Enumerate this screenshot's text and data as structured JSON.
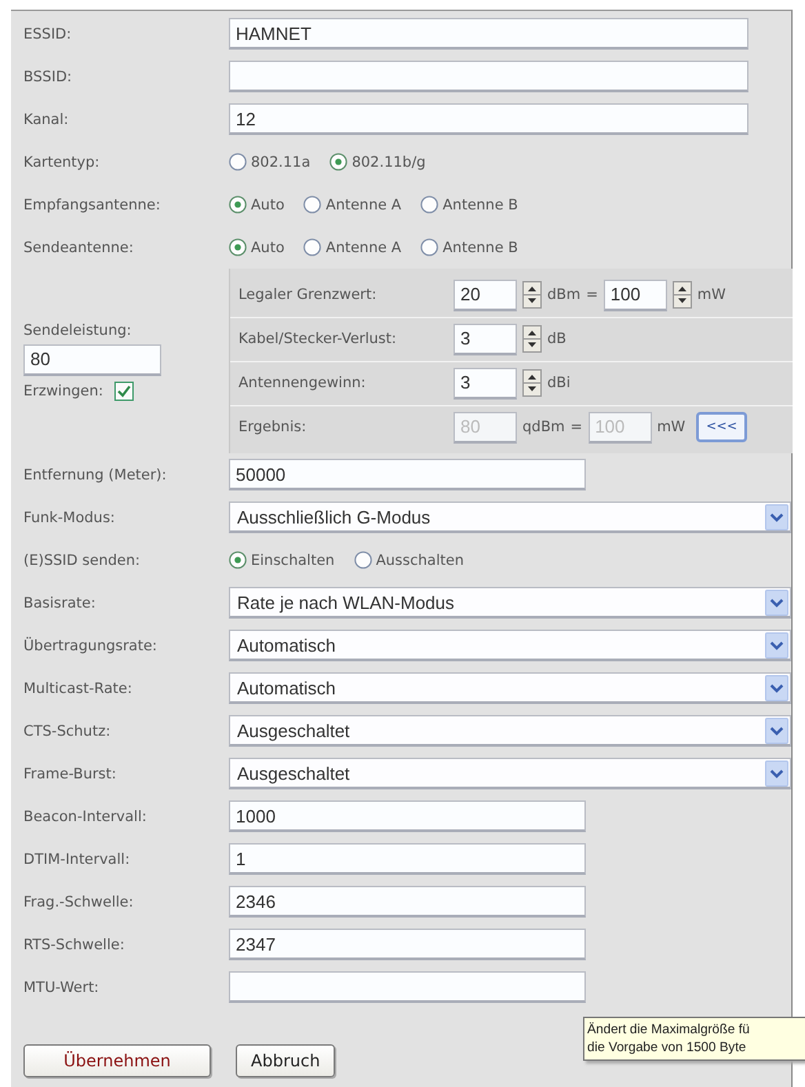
{
  "section_1": [
    {
      "kind": "text",
      "label": "ESSID:",
      "value": "HAMNET"
    },
    {
      "kind": "text",
      "label": "BSSID:"
    },
    {
      "kind": "text",
      "label": "Kanal:",
      "value": "12"
    },
    {
      "kind": "radio",
      "label": "Kartentyp:",
      "options": [
        {
          "label": "802.11a",
          "selected": false
        },
        {
          "label": "802.11b/g",
          "selected": true
        }
      ]
    },
    {
      "kind": "radio",
      "label": "Empfangsantenne:",
      "options": [
        {
          "label": "Auto",
          "selected": true
        },
        {
          "label": "Antenne A",
          "selected": false
        },
        {
          "label": "Antenne B",
          "selected": false
        }
      ]
    },
    {
      "kind": "radio",
      "label": "Sendeantenne:",
      "options": [
        {
          "label": "Auto",
          "selected": true
        },
        {
          "label": "Antenne A",
          "selected": false
        },
        {
          "label": "Antenne B",
          "selected": false
        }
      ]
    }
  ],
  "transmit_power": {
    "label": "Sendeleistung:",
    "value": "80",
    "force_label": "Erzwingen:",
    "force_checked": true,
    "lines": [
      {
        "kind": "spin",
        "label": "Legaler Grenzwert:",
        "value": "20",
        "unit": "dBm",
        "equals": "=",
        "value_2": "100",
        "unit_2": "mW"
      },
      {
        "kind": "spin",
        "label": "Kabel/Stecker-Verlust:",
        "value": "3",
        "unit": "dB"
      },
      {
        "kind": "spin",
        "label": "Antennengewinn:",
        "value": "3",
        "unit": "dBi"
      },
      {
        "kind": "result",
        "label": "Ergebnis:",
        "value": "80",
        "unit": "qdBm",
        "equals": "=",
        "value_2": "100",
        "unit_2": "mW",
        "button": "<<<"
      }
    ]
  },
  "section_2": [
    {
      "kind": "text",
      "label": "Entfernung (Meter):",
      "value": "50000"
    },
    {
      "kind": "select",
      "label": "Funk-Modus:",
      "value": "Ausschließlich G-Modus"
    },
    {
      "kind": "radio",
      "label": "(E)SSID senden:",
      "options": [
        {
          "label": "Einschalten",
          "selected": true
        },
        {
          "label": "Ausschalten",
          "selected": false
        }
      ]
    },
    {
      "kind": "select",
      "label": "Basisrate:",
      "value": "Rate je nach WLAN-Modus"
    },
    {
      "kind": "select",
      "label": "Übertragungsrate:",
      "value": "Automatisch"
    },
    {
      "kind": "select",
      "label": "Multicast-Rate:",
      "value": "Automatisch"
    },
    {
      "kind": "select",
      "label": "CTS-Schutz:",
      "value": "Ausgeschaltet"
    },
    {
      "kind": "select",
      "label": "Frame-Burst:",
      "value": "Ausgeschaltet"
    },
    {
      "kind": "text",
      "label": "Beacon-Intervall:",
      "value": "1000"
    },
    {
      "kind": "text",
      "label": "DTIM-Intervall:",
      "value": "1"
    },
    {
      "kind": "text",
      "label": "Frag.-Schwelle:",
      "value": "2346"
    },
    {
      "kind": "text",
      "label": "RTS-Schwelle:",
      "value": "2347"
    },
    {
      "kind": "text",
      "label": "MTU-Wert:"
    }
  ],
  "buttons": [
    {
      "label": "Übernehmen",
      "default": true
    },
    {
      "label": "Abbruch",
      "default": false
    }
  ],
  "tooltip": {
    "lines": [
      "Ändert die Maximalgröße fü",
      "die Vorgabe von 1500 Byte"
    ]
  }
}
